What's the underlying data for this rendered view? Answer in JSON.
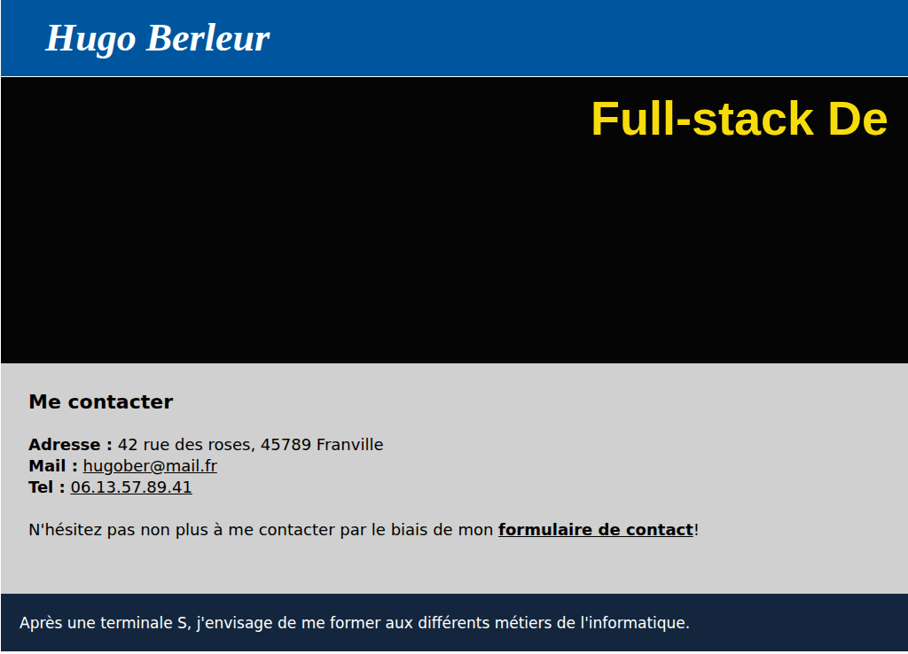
{
  "header": {
    "title": "Hugo Berleur"
  },
  "hero": {
    "title": "Full-stack De"
  },
  "contact": {
    "heading": "Me contacter",
    "fields": [
      {
        "label": "Adresse :",
        "value": "42 rue des roses, 45789 Franville",
        "link": false
      },
      {
        "label": "Mail :",
        "value": "hugober@mail.fr",
        "link": true
      },
      {
        "label": "Tel :",
        "value": "06.13.57.89.41",
        "link": true
      }
    ],
    "message": {
      "text": "N'hésitez pas non plus à me contacter par le biais de mon ",
      "link_text": "formulaire de contact",
      "suffix": "!"
    }
  },
  "footer": {
    "text": "Après une terminale S, j'envisage de me former aux différents métiers de l'informatique."
  }
}
